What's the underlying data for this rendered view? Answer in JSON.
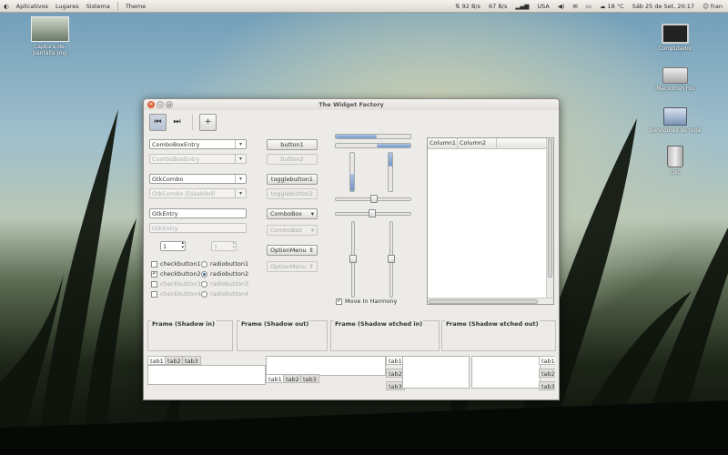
{
  "panel": {
    "menus": [
      "Aplicativos",
      "Lugares",
      "Sistema"
    ],
    "app": "Theme",
    "net_down": "92 B/s",
    "net_up": "67 B/s",
    "keyboard": "USA",
    "temp": "18 °C",
    "datetime": "Sáb 25 de Set, 20:17",
    "user": "fran"
  },
  "desktop": {
    "file_label": "Captura-de-pantalla.png",
    "icons": [
      "Computador",
      "Macintosh HD",
      "Servidores de rede",
      "Lixo"
    ]
  },
  "window": {
    "title": "The Widget Factory",
    "combos": [
      "ComboBoxEntry",
      "ComboBoxEntry",
      "GtkCombo",
      "GtkCombo (Disabled)"
    ],
    "entries": [
      "GtkEntry",
      "GtkEntry"
    ],
    "spin_values": [
      "1",
      "1"
    ],
    "checks": [
      "checkbutton1",
      "checkbutton2",
      "checkbutton3",
      "checkbutton4"
    ],
    "radios": [
      "radiobutton1",
      "radiobutton2",
      "radiobutton3",
      "radiobutton4"
    ],
    "buttons": [
      "button1",
      "button2",
      "togglebutton1",
      "togglebutton2",
      "ComboBox",
      "ComboBox",
      "OptionMenu",
      "OptionMenu"
    ],
    "move_harmony": "Move In Harmony",
    "columns": [
      "Column1",
      "Column2"
    ],
    "frames": [
      "Frame (Shadow in)",
      "Frame (Shadow out)",
      "Frame (Shadow etched in)",
      "Frame (Shadow etched out)"
    ],
    "tabs": [
      "tab1",
      "tab2",
      "tab3"
    ],
    "progress_h": [
      0.55,
      0.45
    ],
    "progress_v": [
      0.45,
      0.35
    ]
  }
}
